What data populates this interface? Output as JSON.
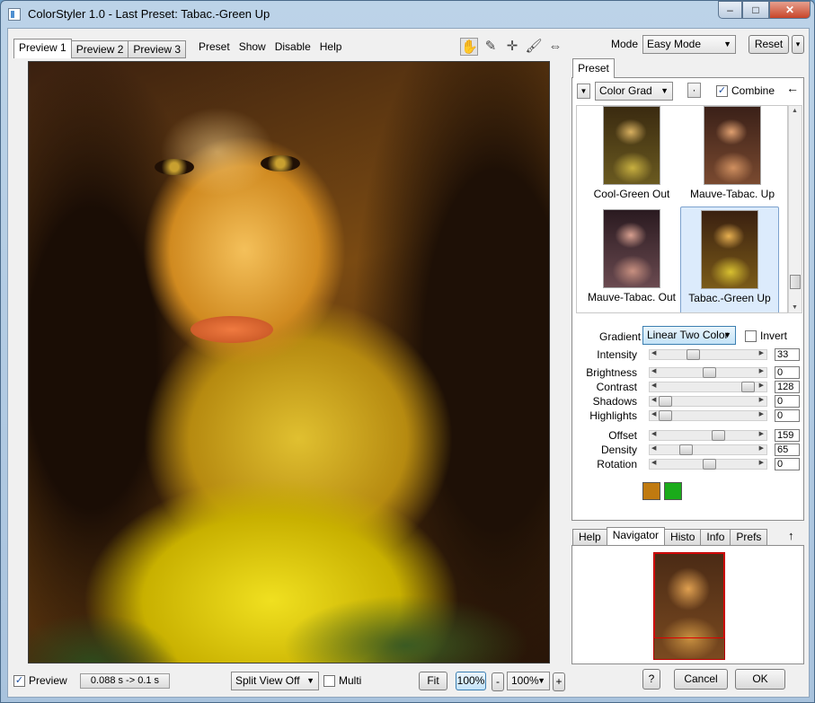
{
  "window": {
    "title": "ColorStyler 1.0 - Last Preset: Tabac.-Green Up",
    "buttons": {
      "minimize": "–",
      "maximize": "□",
      "close": "✕"
    }
  },
  "preview_tabs": [
    "Preview 1",
    "Preview 2",
    "Preview 3"
  ],
  "menu": [
    "Preset",
    "Show",
    "Disable",
    "Help"
  ],
  "tools": [
    "hand-icon",
    "eyedropper-icon",
    "crosshair-icon",
    "brush-icon",
    "split-arrows-icon"
  ],
  "mode": {
    "label": "Mode",
    "value": "Easy Mode",
    "reset": "Reset",
    "reset_menu": "▾"
  },
  "preset_panel": {
    "tab": "Preset",
    "category": "Color Grad",
    "dot_button": "·",
    "combine_label": "Combine",
    "combine_checked": true,
    "presets": [
      {
        "name": "Cool-Green Out",
        "selected": false
      },
      {
        "name": "Mauve-Tabac. Up",
        "selected": false
      },
      {
        "name": "Mauve-Tabac. Out",
        "selected": false
      },
      {
        "name": "Tabac.-Green Up",
        "selected": true
      }
    ],
    "gradient_label": "Gradient",
    "gradient_value": "Linear Two Color",
    "invert_label": "Invert",
    "invert_checked": false,
    "params": [
      {
        "label": "Intensity",
        "value": "33",
        "fraction": 0.33
      },
      {
        "label": "Brightness",
        "value": "0",
        "fraction": 0.5
      },
      {
        "label": "Contrast",
        "value": "128",
        "fraction": 0.93
      },
      {
        "label": "Shadows",
        "value": "0",
        "fraction": 0.02
      },
      {
        "label": "Highlights",
        "value": "0",
        "fraction": 0.02
      },
      {
        "label": "Offset",
        "value": "159",
        "fraction": 0.6
      },
      {
        "label": "Density",
        "value": "65",
        "fraction": 0.25
      },
      {
        "label": "Rotation",
        "value": "0",
        "fraction": 0.5
      }
    ],
    "colors": [
      "#c07a10",
      "#1aab1a"
    ]
  },
  "bottom_tabs": [
    "Help",
    "Navigator",
    "Histo",
    "Info",
    "Prefs"
  ],
  "bottom_tab_active": "Navigator",
  "status": {
    "preview_label": "Preview",
    "preview_checked": true,
    "timing": "0.088 s -> 0.1 s",
    "split_view": "Split View Off",
    "multi_label": "Multi",
    "multi_checked": false,
    "fit": "Fit",
    "zoom_100": "100%",
    "zoom_minus": "-",
    "zoom_value": "100%",
    "zoom_plus": "+",
    "help_button": "?",
    "cancel": "Cancel",
    "ok": "OK"
  }
}
